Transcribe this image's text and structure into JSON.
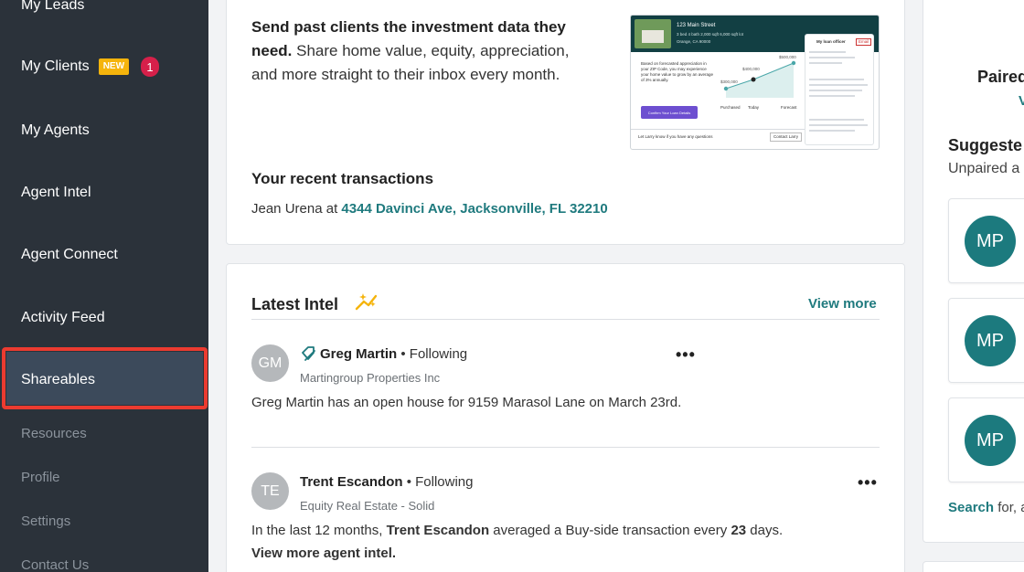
{
  "sidebar": {
    "items": [
      {
        "label": "My Leads"
      },
      {
        "label": "My Clients",
        "badge": "NEW",
        "count": "1"
      },
      {
        "label": "My Agents"
      },
      {
        "label": "Agent Intel"
      },
      {
        "label": "Agent Connect"
      },
      {
        "label": "Activity Feed"
      },
      {
        "label": "Shareables",
        "active": true
      },
      {
        "label": "Resources"
      },
      {
        "label": "Profile"
      },
      {
        "label": "Settings"
      },
      {
        "label": "Contact Us"
      }
    ]
  },
  "promo": {
    "bold": "Send past clients the investment data they need.",
    "rest": " Share home value, equity, appreciation, and more straight to their inbox every month.",
    "preview": {
      "address": "123 Main Street",
      "sub": "3 bed  4 bath  2,000 sqft  6,000 sqft lot",
      "city": "Orange, CA 90000",
      "body": "Based on forecasted appreciation in your ZIP Code, you may experience your home value to grow by an average of 3% annually.",
      "button": "Confirm Your Loan Details",
      "officer": "My loan officer",
      "email_btn": "Email",
      "footer": "Let Larry know if you have any questions",
      "contact": "Contact Larry",
      "chart_labels": [
        "Purchased",
        "Today",
        "Forecast"
      ],
      "values": [
        "$300,000",
        "$400,000",
        "$500,000"
      ]
    }
  },
  "transactions": {
    "title": "Your recent transactions",
    "agent": "Jean Urena",
    "at": " at ",
    "address": "4344 Davinci Ave, Jacksonville, FL 32210"
  },
  "intel": {
    "title": "Latest Intel",
    "view_more": "View more",
    "posts": [
      {
        "initials": "GM",
        "name": "Greg Martin",
        "status": "• Following",
        "company": "Martingroup Properties Inc",
        "body": "Greg Martin has an open house for 9159 Marasol Lane on March 23rd."
      },
      {
        "initials": "TE",
        "name": "Trent Escandon",
        "status": "• Following",
        "company": "Equity Real Estate - Solid",
        "body_a": "In the last 12 months, ",
        "body_name": "Trent Escandon",
        "body_b": " averaged a Buy-side transaction every ",
        "body_days": "23",
        "body_c": " days.",
        "link": "View more agent intel."
      }
    ]
  },
  "right": {
    "paired_title": "Paired",
    "paired_link": "V",
    "suggested_title": "Suggeste",
    "unpaired": "Unpaired a",
    "cards": [
      {
        "initials": "MP"
      },
      {
        "initials": "MP"
      },
      {
        "initials": "MP"
      }
    ],
    "search_link": "Search",
    "search_rest": " for, a"
  },
  "colors": {
    "sidebar_bg": "#2b323a",
    "accent_teal": "#1f7a7e",
    "highlight_red": "#ec3b30",
    "badge_yellow": "#f5b40c",
    "badge_red": "#d6204a"
  }
}
